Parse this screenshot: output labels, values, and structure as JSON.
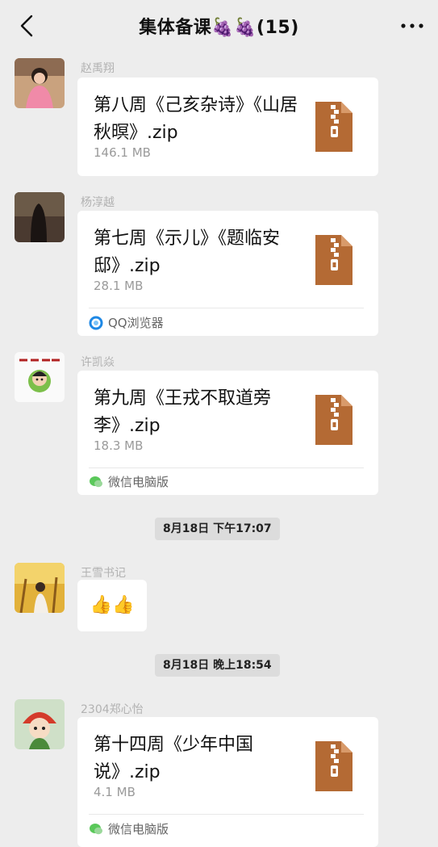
{
  "header": {
    "title": "集体备课🍇🍇(15)"
  },
  "messages": [
    {
      "sender": "赵禹翔",
      "file_name": "第八周《己亥杂诗》《山居秋暝》.zip",
      "file_size": "146.1 MB"
    },
    {
      "sender": "杨淳越",
      "file_name": "第七周《示儿》《题临安邸》.zip",
      "file_size": "28.1 MB",
      "source": "QQ浏览器"
    },
    {
      "sender": "许凯焱",
      "file_name": "第九周《王戎不取道旁李》.zip",
      "file_size": "18.3 MB",
      "source": "微信电脑版"
    },
    {
      "sender": "王雪书记",
      "content": "👍👍"
    },
    {
      "sender": "2304郑心怡",
      "file_name": "第十四周《少年中国说》.zip",
      "file_size": "4.1 MB",
      "source": "微信电脑版"
    }
  ],
  "timestamps": [
    "8月18日 下午17:07",
    "8月18日 晚上18:54"
  ],
  "icons": {
    "back": "chevron-left-icon",
    "more": "more-dots-icon",
    "file": "zip-file-icon",
    "qq_browser": "qq-browser-icon",
    "wechat_pc": "wechat-pc-icon"
  },
  "colors": {
    "background": "#ededed",
    "bubble": "#ffffff",
    "zip_icon": "#b46a34",
    "time_pill": "#dcdcdc"
  }
}
